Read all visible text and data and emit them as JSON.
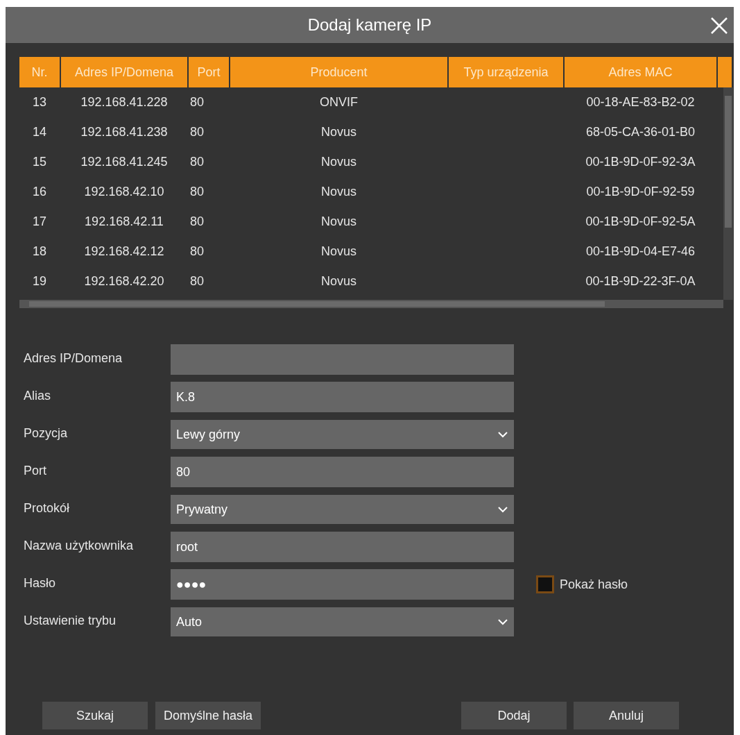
{
  "window": {
    "title": "Dodaj kamerę IP"
  },
  "table": {
    "columns": [
      "Nr.",
      "Adres IP/Domena",
      "Port",
      "Producent",
      "Typ urządzenia",
      "Adres MAC"
    ],
    "rows": [
      {
        "nr": "13",
        "address": "192.168.41.228",
        "port": "80",
        "producer": "ONVIF",
        "mac": "00-18-AE-83-B2-02"
      },
      {
        "nr": "14",
        "address": "192.168.41.238",
        "port": "80",
        "producer": "Novus",
        "mac": "68-05-CA-36-01-B0"
      },
      {
        "nr": "15",
        "address": "192.168.41.245",
        "port": "80",
        "producer": "Novus",
        "mac": "00-1B-9D-0F-92-3A"
      },
      {
        "nr": "16",
        "address": "192.168.42.10",
        "port": "80",
        "producer": "Novus",
        "mac": "00-1B-9D-0F-92-59"
      },
      {
        "nr": "17",
        "address": "192.168.42.11",
        "port": "80",
        "producer": "Novus",
        "mac": "00-1B-9D-0F-92-5A"
      },
      {
        "nr": "18",
        "address": "192.168.42.12",
        "port": "80",
        "producer": "Novus",
        "mac": "00-1B-9D-04-E7-46"
      },
      {
        "nr": "19",
        "address": "192.168.42.20",
        "port": "80",
        "producer": "Novus",
        "mac": "00-1B-9D-22-3F-0A"
      }
    ]
  },
  "form": [
    {
      "kind": "text",
      "label": "Adres IP/Domena"
    },
    {
      "kind": "text",
      "label": "Alias",
      "value": "K.8"
    },
    {
      "kind": "select",
      "label": "Pozycja",
      "value": "Lewy górny"
    },
    {
      "kind": "text",
      "label": "Port",
      "value": "80"
    },
    {
      "kind": "select",
      "label": "Protokół",
      "value": "Prywatny"
    },
    {
      "kind": "text",
      "label": "Nazwa użytkownika",
      "value": "root"
    },
    {
      "kind": "password",
      "label": "Hasło",
      "value": "●●●●",
      "show_password": {
        "label": "Pokaż hasło",
        "checked": false
      }
    },
    {
      "kind": "select",
      "label": "Ustawienie trybu",
      "value": "Auto"
    }
  ],
  "buttons_left": [
    "Szukaj",
    "Domyślne hasła"
  ],
  "buttons_right": [
    "Dodaj",
    "Anuluj"
  ]
}
